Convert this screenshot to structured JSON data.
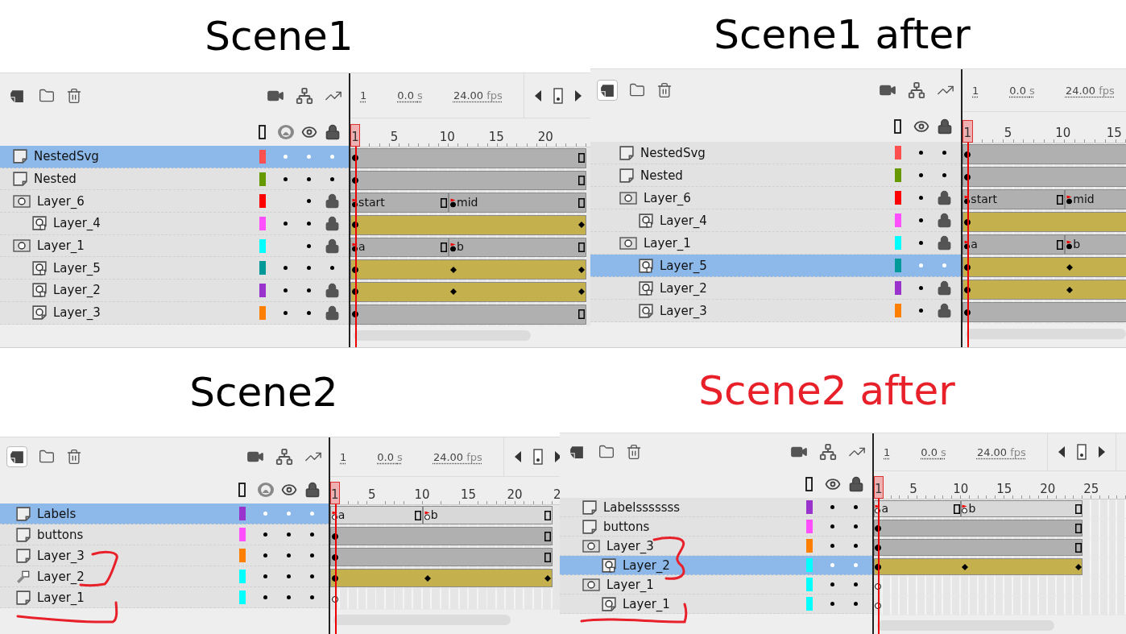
{
  "panels": [
    {
      "title": "Scene1",
      "color": "#000000",
      "new_layer_active": false,
      "onion_column": true,
      "transport": {
        "kind": "basic"
      },
      "frame": "1",
      "time": "0.0",
      "time_unit": "s",
      "rate": "24.00",
      "rate_unit": "fps",
      "ticks": [
        "1",
        "5",
        "10",
        "15",
        "20"
      ],
      "layers": [
        {
          "name": "NestedSvg",
          "kind": "layer",
          "color": "#ff5050",
          "selected": true,
          "onion": true,
          "locked": false,
          "track": {
            "kind": "static"
          }
        },
        {
          "name": "Nested",
          "kind": "layer",
          "color": "#669900",
          "selected": false,
          "onion": true,
          "locked": false,
          "track": {
            "kind": "static"
          }
        },
        {
          "name": "Layer_6",
          "kind": "mask",
          "color": "#ff0000",
          "selected": false,
          "onion": false,
          "locked": true,
          "track": {
            "kind": "static",
            "segments": [
              "start",
              "mid"
            ]
          },
          "children": [
            {
              "name": "Layer_4",
              "kind": "masked",
              "color": "#ff4fff",
              "selected": false,
              "onion": true,
              "locked": true,
              "track": {
                "kind": "tween",
                "mid_key": false
              }
            }
          ]
        },
        {
          "name": "Layer_1",
          "kind": "mask",
          "color": "#00ffff",
          "selected": false,
          "onion": false,
          "locked": true,
          "track": {
            "kind": "static",
            "segments": [
              "a",
              "b"
            ]
          },
          "children": [
            {
              "name": "Layer_5",
              "kind": "masked",
              "color": "#009999",
              "selected": false,
              "onion": true,
              "locked": false,
              "track": {
                "kind": "tween",
                "mid_key": true
              }
            },
            {
              "name": "Layer_2",
              "kind": "masked",
              "color": "#9933cc",
              "selected": false,
              "onion": true,
              "locked": true,
              "track": {
                "kind": "tween",
                "mid_key": true
              }
            },
            {
              "name": "Layer_3",
              "kind": "masked_plain",
              "color": "#ff8000",
              "selected": false,
              "onion": true,
              "locked": true,
              "track": {
                "kind": "static"
              }
            }
          ]
        }
      ]
    },
    {
      "title": "Scene1 after",
      "color": "#000000",
      "new_layer_active": true,
      "frame": "1",
      "time": "0.0",
      "time_unit": "s",
      "rate": "24.00",
      "rate_unit": "fps",
      "ticks": [
        "1",
        "5",
        "10",
        "15"
      ],
      "layers": [
        {
          "name": "NestedSvg",
          "kind": "layer",
          "color": "#ff5050",
          "selected": false,
          "locked": false,
          "track": {
            "kind": "static"
          }
        },
        {
          "name": "Nested",
          "kind": "layer",
          "color": "#669900",
          "selected": false,
          "locked": false,
          "track": {
            "kind": "static"
          }
        },
        {
          "name": "Layer_6",
          "kind": "mask",
          "color": "#ff0000",
          "selected": false,
          "locked": true,
          "track": {
            "kind": "static",
            "segments": [
              "start",
              "mid"
            ]
          },
          "children": [
            {
              "name": "Layer_4",
              "kind": "masked",
              "color": "#ff4fff",
              "selected": false,
              "locked": true,
              "track": {
                "kind": "tween",
                "mid_key": false
              }
            }
          ]
        },
        {
          "name": "Layer_1",
          "kind": "mask",
          "color": "#00ffff",
          "selected": false,
          "locked": true,
          "track": {
            "kind": "static",
            "segments": [
              "a",
              "b"
            ]
          },
          "children": [
            {
              "name": "Layer_5",
              "kind": "masked",
              "color": "#009999",
              "selected": true,
              "locked": false,
              "track": {
                "kind": "tween",
                "mid_key": true
              }
            },
            {
              "name": "Layer_2",
              "kind": "masked",
              "color": "#9933cc",
              "selected": false,
              "locked": true,
              "track": {
                "kind": "tween",
                "mid_key": true
              }
            },
            {
              "name": "Layer_3",
              "kind": "masked_plain",
              "color": "#ff8000",
              "selected": false,
              "locked": true,
              "track": {
                "kind": "static"
              }
            }
          ]
        }
      ]
    },
    {
      "title": "Scene2",
      "color": "#000000",
      "new_layer_active": true,
      "onion_column": true,
      "transport": {
        "kind": "basic"
      },
      "annotated": true,
      "frame": "1",
      "time": "0.0",
      "time_unit": "s",
      "rate": "24.00",
      "rate_unit": "fps",
      "ticks": [
        "1",
        "5",
        "10",
        "15",
        "20",
        "2"
      ],
      "layers": [
        {
          "name": "Labels",
          "kind": "layer",
          "color": "#9933cc",
          "selected": true,
          "onion": true,
          "locked": false,
          "track": {
            "kind": "labels",
            "segments": [
              "a",
              "b"
            ]
          }
        },
        {
          "name": "buttons",
          "kind": "layer",
          "color": "#ff4fff",
          "selected": false,
          "onion": true,
          "locked": false,
          "track": {
            "kind": "static"
          }
        },
        {
          "name": "Layer_3",
          "kind": "layer",
          "color": "#ff8000",
          "selected": false,
          "onion": true,
          "locked": false,
          "track": {
            "kind": "static"
          }
        },
        {
          "name": "Layer_2",
          "kind": "guide",
          "color": "#00ffff",
          "selected": false,
          "onion": true,
          "locked": false,
          "track": {
            "kind": "tween",
            "mid_key": true
          }
        },
        {
          "name": "Layer_1",
          "kind": "layer",
          "color": "#00ffff",
          "selected": false,
          "onion": true,
          "locked": false,
          "track": {
            "kind": "empty"
          }
        }
      ]
    },
    {
      "title": "Scene2 after",
      "color": "#e8202a",
      "new_layer_active": false,
      "transport": {
        "kind": "extended"
      },
      "annotated": true,
      "frame": "1",
      "time": "0.0",
      "time_unit": "s",
      "rate": "24.00",
      "rate_unit": "fps",
      "ticks": [
        "1",
        "5",
        "10",
        "15",
        "20",
        "25"
      ],
      "layers": [
        {
          "name": "Labelsssssss",
          "kind": "layer",
          "color": "#9933cc",
          "selected": false,
          "locked": false,
          "track": {
            "kind": "labels",
            "segments": [
              "a",
              "b"
            ]
          }
        },
        {
          "name": "buttons",
          "kind": "layer",
          "color": "#ff4fff",
          "selected": false,
          "locked": false,
          "track": {
            "kind": "static"
          }
        },
        {
          "name": "Layer_3",
          "kind": "mask",
          "color": "#ff8000",
          "selected": false,
          "locked": false,
          "track": {
            "kind": "static"
          },
          "children": [
            {
              "name": "Layer_2",
              "kind": "masked",
              "color": "#00ffff",
              "selected": true,
              "locked": false,
              "track": {
                "kind": "tween",
                "mid_key": true
              }
            }
          ]
        },
        {
          "name": "Layer_1",
          "kind": "mask",
          "color": "#00ffff",
          "selected": false,
          "locked": false,
          "track": {
            "kind": "empty"
          },
          "children": [
            {
              "name": "Layer_1",
              "kind": "masked_plain",
              "color": "#00ffff",
              "selected": false,
              "locked": false,
              "track": {
                "kind": "empty"
              }
            }
          ]
        }
      ]
    }
  ]
}
